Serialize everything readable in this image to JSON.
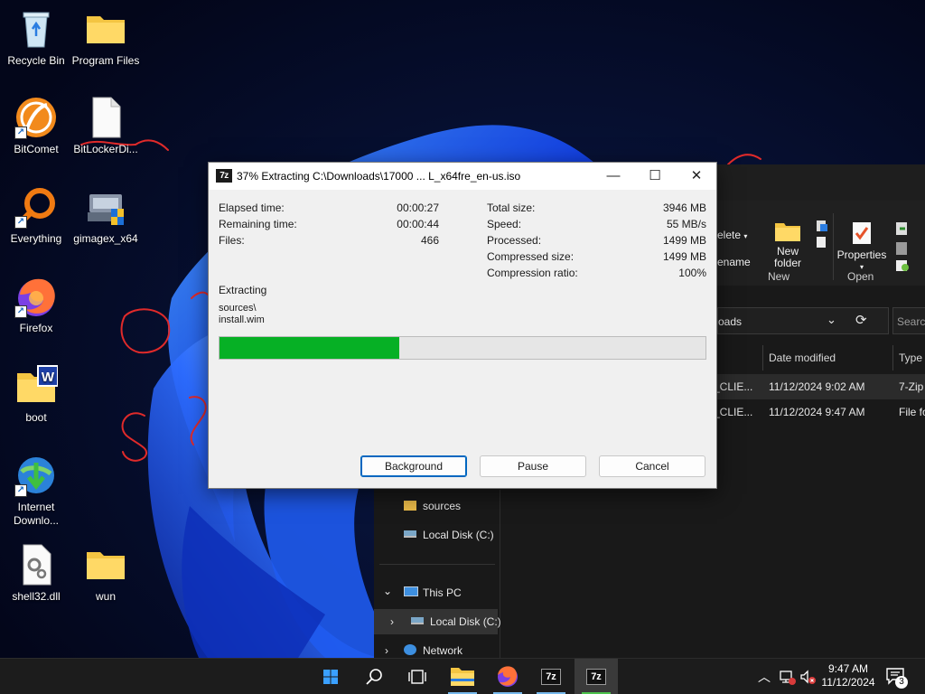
{
  "desktop": {
    "icons": [
      {
        "label": "Recycle Bin",
        "icon": "recycle-bin-icon"
      },
      {
        "label": "Program Files",
        "icon": "folder-icon"
      },
      {
        "label": "BitComet",
        "icon": "bitcomet-icon"
      },
      {
        "label": "BitLockerDi...",
        "icon": "file-icon"
      },
      {
        "label": "Everything",
        "icon": "everything-search-icon"
      },
      {
        "label": "gimagex_x64",
        "icon": "gimagex-icon"
      },
      {
        "label": "Firefox",
        "icon": "firefox-icon"
      },
      {
        "label": "boot",
        "icon": "boot-folder-icon"
      },
      {
        "label": "Internet Downlo...",
        "icon": "internet-download-manager-icon"
      },
      {
        "label": "shell32.dll",
        "icon": "dll-file-icon"
      },
      {
        "label": "wun",
        "icon": "folder-icon"
      }
    ]
  },
  "explorer": {
    "ribbon": {
      "delete_label": "elete",
      "rename_label": "ename",
      "new_folder_label": "New folder",
      "properties_label": "Properties",
      "group_new": "New",
      "group_open": "Open"
    },
    "address_text": "oads",
    "search_placeholder": "Search",
    "columns": {
      "date_modified": "Date modified",
      "type": "Type"
    },
    "files": [
      {
        "name": "_CLIE...",
        "date": "11/12/2024 9:02 AM",
        "type": "7-Zip"
      },
      {
        "name": "_CLIE...",
        "date": "11/12/2024 9:47 AM",
        "type": "File fo"
      }
    ],
    "nav": {
      "sources": "sources",
      "local_disk": "Local Disk (C:)",
      "this_pc": "This PC",
      "local_disk_2": "Local Disk (C:)",
      "network": "Network"
    }
  },
  "dialog": {
    "app_icon": "7z",
    "title": "37% Extracting C:\\Downloads\\17000 ... L_x64fre_en-us.iso",
    "left_stats": [
      {
        "label": "Elapsed time:",
        "value": "00:00:27"
      },
      {
        "label": "Remaining time:",
        "value": "00:00:44"
      },
      {
        "label": "Files:",
        "value": "466"
      }
    ],
    "right_stats": [
      {
        "label": "Total size:",
        "value": "3946 MB"
      },
      {
        "label": "Speed:",
        "value": "55 MB/s"
      },
      {
        "label": "Processed:",
        "value": "1499 MB"
      },
      {
        "label": "Compressed size:",
        "value": "1499 MB"
      },
      {
        "label": "Compression ratio:",
        "value": "100%"
      }
    ],
    "status_heading": "Extracting",
    "current_path": "sources\\",
    "current_file": "install.wim",
    "progress": 0.37,
    "buttons": {
      "background": "Background",
      "pause": "Pause",
      "cancel": "Cancel"
    },
    "caption": {
      "minimize": "—",
      "maximize": "☐",
      "close": "✕"
    }
  },
  "taskbar": {
    "zip_label": "7z",
    "clock_time": "9:47 AM",
    "clock_date": "11/12/2024",
    "notification_count": "3"
  },
  "colors": {
    "progress_fill": "#06b025",
    "accent": "#0067c0",
    "taskbar": "#1c1c1c"
  }
}
